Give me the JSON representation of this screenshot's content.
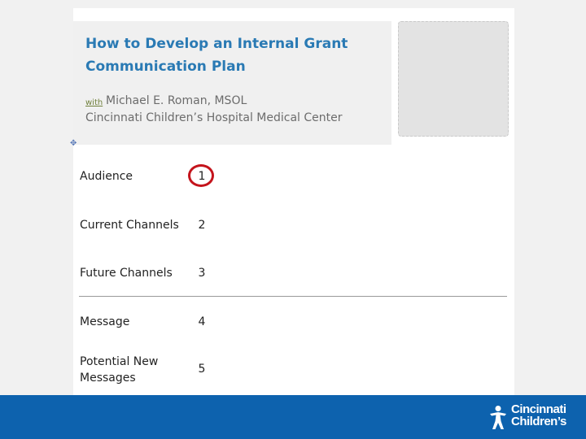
{
  "document": {
    "title_line1": "How to Develop an Internal Grant",
    "title_line2": "Communication Plan",
    "with_label": "with",
    "presenter": "Michael E. Roman, MSOL",
    "affiliation": "Cincinnati Children’s Hospital Medical Center",
    "anchor_icon": "table-move-handle-icon"
  },
  "rows": [
    {
      "label": "Audience",
      "number": "1"
    },
    {
      "label": "Current Channels",
      "number": "2"
    },
    {
      "label": "Future Channels",
      "number": "3"
    },
    {
      "label": "Message",
      "number": "4"
    },
    {
      "label_line1": "Potential New",
      "label_line2": "Messages",
      "number": "5"
    }
  ],
  "highlight": {
    "color": "#c4141c",
    "target_row_number": "1"
  },
  "footer": {
    "color": "#0d62ae",
    "logo_line1": "Cincinnati",
    "logo_line2": "Children’s",
    "logo_icon": "cincinnati-childrens-figure-icon"
  }
}
